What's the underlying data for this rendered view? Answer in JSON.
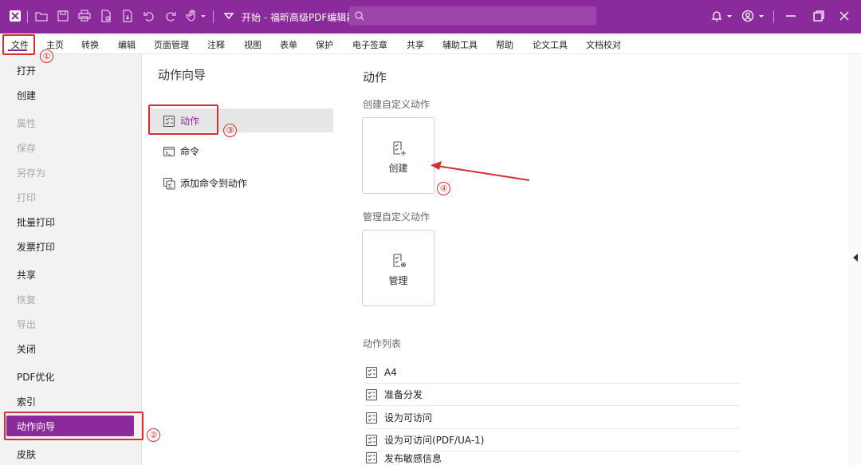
{
  "titlebar": {
    "title": "开始 - 福昕高级PDF编辑器",
    "icons": [
      "app-logo-icon",
      "open-folder-icon",
      "save-icon",
      "print-icon",
      "file-icon",
      "file-export-icon",
      "undo-icon",
      "redo-icon",
      "hand-tool-icon",
      "dropdown-icon",
      "search-icon",
      "bell-icon",
      "user-icon",
      "minimize-icon",
      "restore-icon",
      "close-icon"
    ],
    "accent_color": "#8b2a9a"
  },
  "menu": {
    "items": [
      "文件",
      "主页",
      "转换",
      "编辑",
      "页面管理",
      "注释",
      "视图",
      "表单",
      "保护",
      "电子签章",
      "共享",
      "辅助工具",
      "帮助",
      "论文工具",
      "文档校对"
    ],
    "active": "文件"
  },
  "left_panel": {
    "items": [
      {
        "label": "打开",
        "disabled": false
      },
      {
        "label": "创建",
        "disabled": false
      },
      {
        "label": "属性",
        "disabled": true
      },
      {
        "label": "保存",
        "disabled": true
      },
      {
        "label": "另存为",
        "disabled": true
      },
      {
        "label": "打印",
        "disabled": true
      },
      {
        "label": "批量打印",
        "disabled": false
      },
      {
        "label": "发票打印",
        "disabled": false
      },
      {
        "label": "共享",
        "disabled": false
      },
      {
        "label": "恢复",
        "disabled": true
      },
      {
        "label": "导出",
        "disabled": true
      },
      {
        "label": "关闭",
        "disabled": false
      },
      {
        "label": "PDF优化",
        "disabled": false
      },
      {
        "label": "索引",
        "disabled": false
      },
      {
        "label": "动作向导",
        "disabled": false
      },
      {
        "label": "皮肤",
        "disabled": false
      }
    ],
    "active": "动作向导"
  },
  "middle_panel": {
    "title": "动作向导",
    "items": [
      {
        "label": "动作",
        "icon": "action-icon"
      },
      {
        "label": "命令",
        "icon": "command-icon"
      },
      {
        "label": "添加命令到动作",
        "icon": "add-command-icon"
      }
    ],
    "selected": "动作"
  },
  "content": {
    "title": "动作",
    "create_section": "创建自定义动作",
    "create_tile": "创建",
    "manage_section": "管理自定义动作",
    "manage_tile": "管理",
    "list_title": "动作列表",
    "actions": [
      "A4",
      "准备分发",
      "设为可访问",
      "设为可访问(PDF/UA-1)",
      "发布敏感信息"
    ]
  },
  "annotations": {
    "numbers": [
      "①",
      "②",
      "③",
      "④"
    ],
    "color": "#d32f2f"
  }
}
